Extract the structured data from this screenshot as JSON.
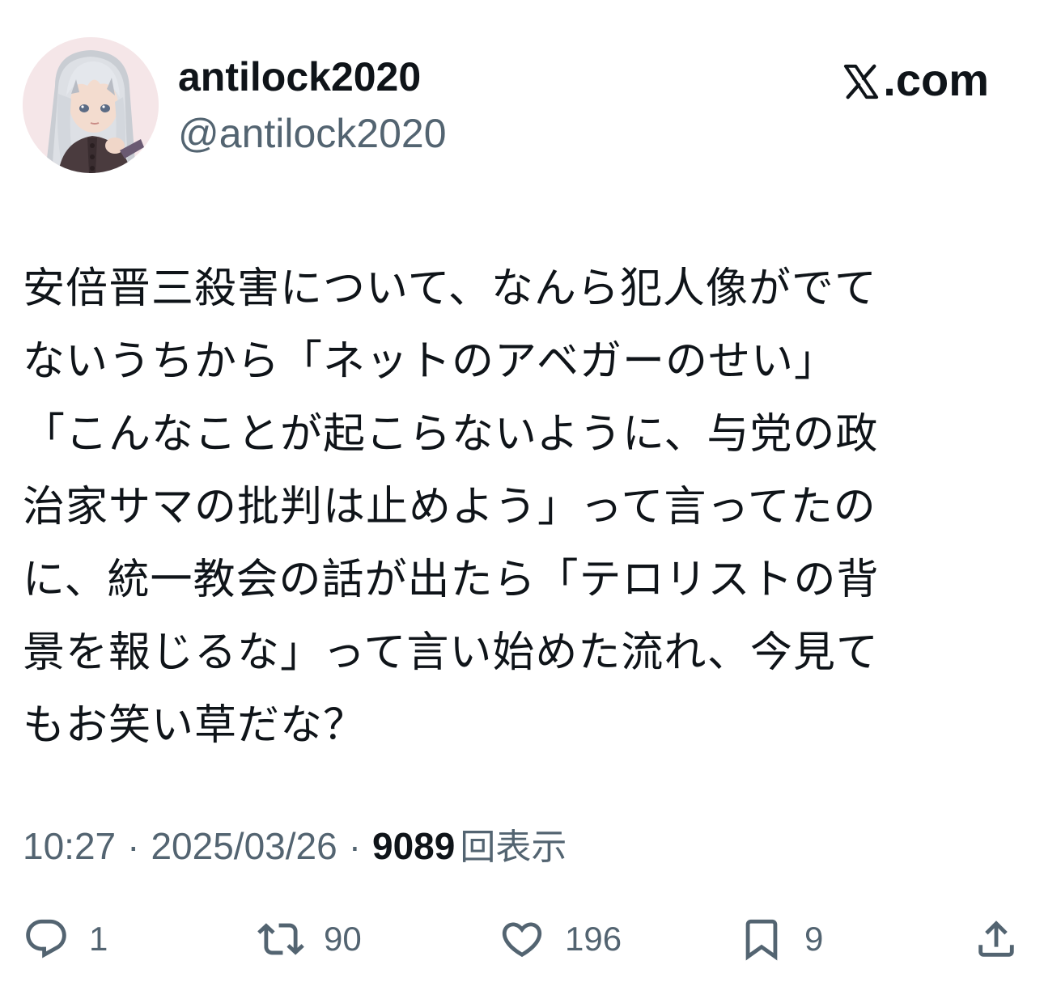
{
  "header": {
    "display_name": "antilock2020",
    "handle": "@antilock2020",
    "brand": ".com",
    "brand_icon": "x-logo-icon",
    "avatar_icon": "anime-girl-avatar"
  },
  "tweet": {
    "text": "安倍晋三殺害について、なんら犯人像がでて\nないうちから「ネットのアベガーのせい」\n「こんなことが起こらないように、与党の政\n治家サマの批判は止めよう」って言ってたの\nに、統一教会の話が出たら「テロリストの背\n景を報じるな」って言い始めた流れ、今見て\nもお笑い草だな？"
  },
  "meta": {
    "time": "10:27",
    "separator": "·",
    "date": "2025/03/26",
    "views_count": "9089",
    "views_label": "回表示"
  },
  "actions": {
    "reply": {
      "icon": "reply-icon",
      "count": "1"
    },
    "retweet": {
      "icon": "retweet-icon",
      "count": "90"
    },
    "like": {
      "icon": "heart-icon",
      "count": "196"
    },
    "bookmark": {
      "icon": "bookmark-icon",
      "count": "9"
    },
    "share": {
      "icon": "share-icon"
    }
  },
  "colors": {
    "text_primary": "#0f1419",
    "text_secondary": "#536471",
    "background": "#ffffff"
  }
}
